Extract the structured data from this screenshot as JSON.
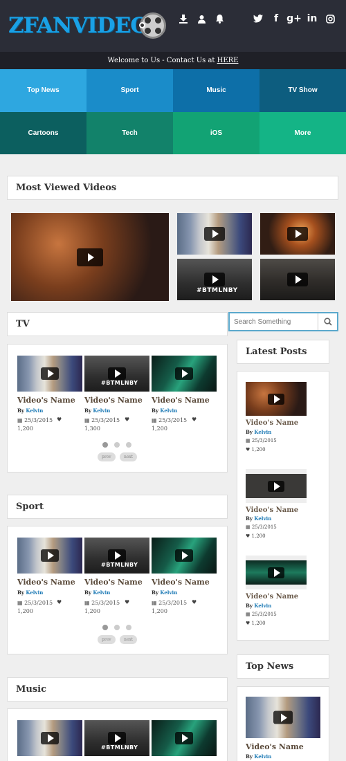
{
  "header": {
    "logo_text": "ZFANVIDEO",
    "welcome_text": "Welcome to Us - Contact Us at",
    "welcome_link": "HERE",
    "icons": [
      "download-icon",
      "user-icon",
      "bell-icon",
      "twitter-icon",
      "facebook-icon",
      "google-plus-icon",
      "linkedin-icon",
      "instagram-icon"
    ],
    "social_labels": {
      "twitter": "🐦",
      "facebook": "f",
      "google": "g+",
      "linkedin": "in",
      "instagram": "◎"
    }
  },
  "categories": [
    {
      "label": "Top News",
      "color": "#2ea7e0"
    },
    {
      "label": "Sport",
      "color": "#1a8cc9"
    },
    {
      "label": "Music",
      "color": "#0d6fa8"
    },
    {
      "label": "TV Show",
      "color": "#0d5d7f"
    },
    {
      "label": "Cartoons",
      "color": "#0c5f5f"
    },
    {
      "label": "Tech",
      "color": "#12826a"
    },
    {
      "label": "iOS",
      "color": "#12a374"
    },
    {
      "label": "More",
      "color": "#14b486"
    }
  ],
  "most_viewed": {
    "title": "Most Viewed Videos"
  },
  "overlays": {
    "btmlnby": "#BTMLNBY"
  },
  "search": {
    "placeholder": "Search Something"
  },
  "sections": [
    {
      "title": "TV",
      "cards": [
        {
          "name": "Video's Name",
          "by": "By",
          "author": "Kelvin",
          "date": "25/3/2015",
          "likes": "1,200"
        },
        {
          "name": "Video's Name",
          "by": "By",
          "author": "Kelvin",
          "date": "25/3/2015",
          "likes": "1,300"
        },
        {
          "name": "Video's Name",
          "by": "By",
          "author": "Kelvin",
          "date": "25/3/2015",
          "likes": "1,200"
        }
      ],
      "prev": "prev",
      "next": "next"
    },
    {
      "title": "Sport",
      "cards": [
        {
          "name": "Video's Name",
          "by": "By",
          "author": "Kelvin",
          "date": "25/3/2015",
          "likes": "1,200"
        },
        {
          "name": "Video's Name",
          "by": "By",
          "author": "Kelvin",
          "date": "25/3/2015",
          "likes": "1,200"
        },
        {
          "name": "Video's Name",
          "by": "By",
          "author": "Kelvin",
          "date": "25/3/2015",
          "likes": "1,200"
        }
      ],
      "prev": "prev",
      "next": "next"
    },
    {
      "title": "Music"
    }
  ],
  "latest_posts": {
    "title": "Latest Posts",
    "items": [
      {
        "name": "Video's Name",
        "by": "By",
        "author": "Kelvin",
        "date": "25/3/2015",
        "likes": "1,200"
      },
      {
        "name": "Video's Name",
        "by": "By",
        "author": "Kelvin",
        "date": "25/3/2015",
        "likes": "1,200"
      },
      {
        "name": "Video's Name",
        "by": "By",
        "author": "Kelvin",
        "date": "25/3/2015",
        "likes": "1,200"
      }
    ]
  },
  "top_news": {
    "title": "Top News",
    "items": [
      {
        "name": "Video's Name",
        "by": "By",
        "author": "Kelvin"
      }
    ]
  }
}
